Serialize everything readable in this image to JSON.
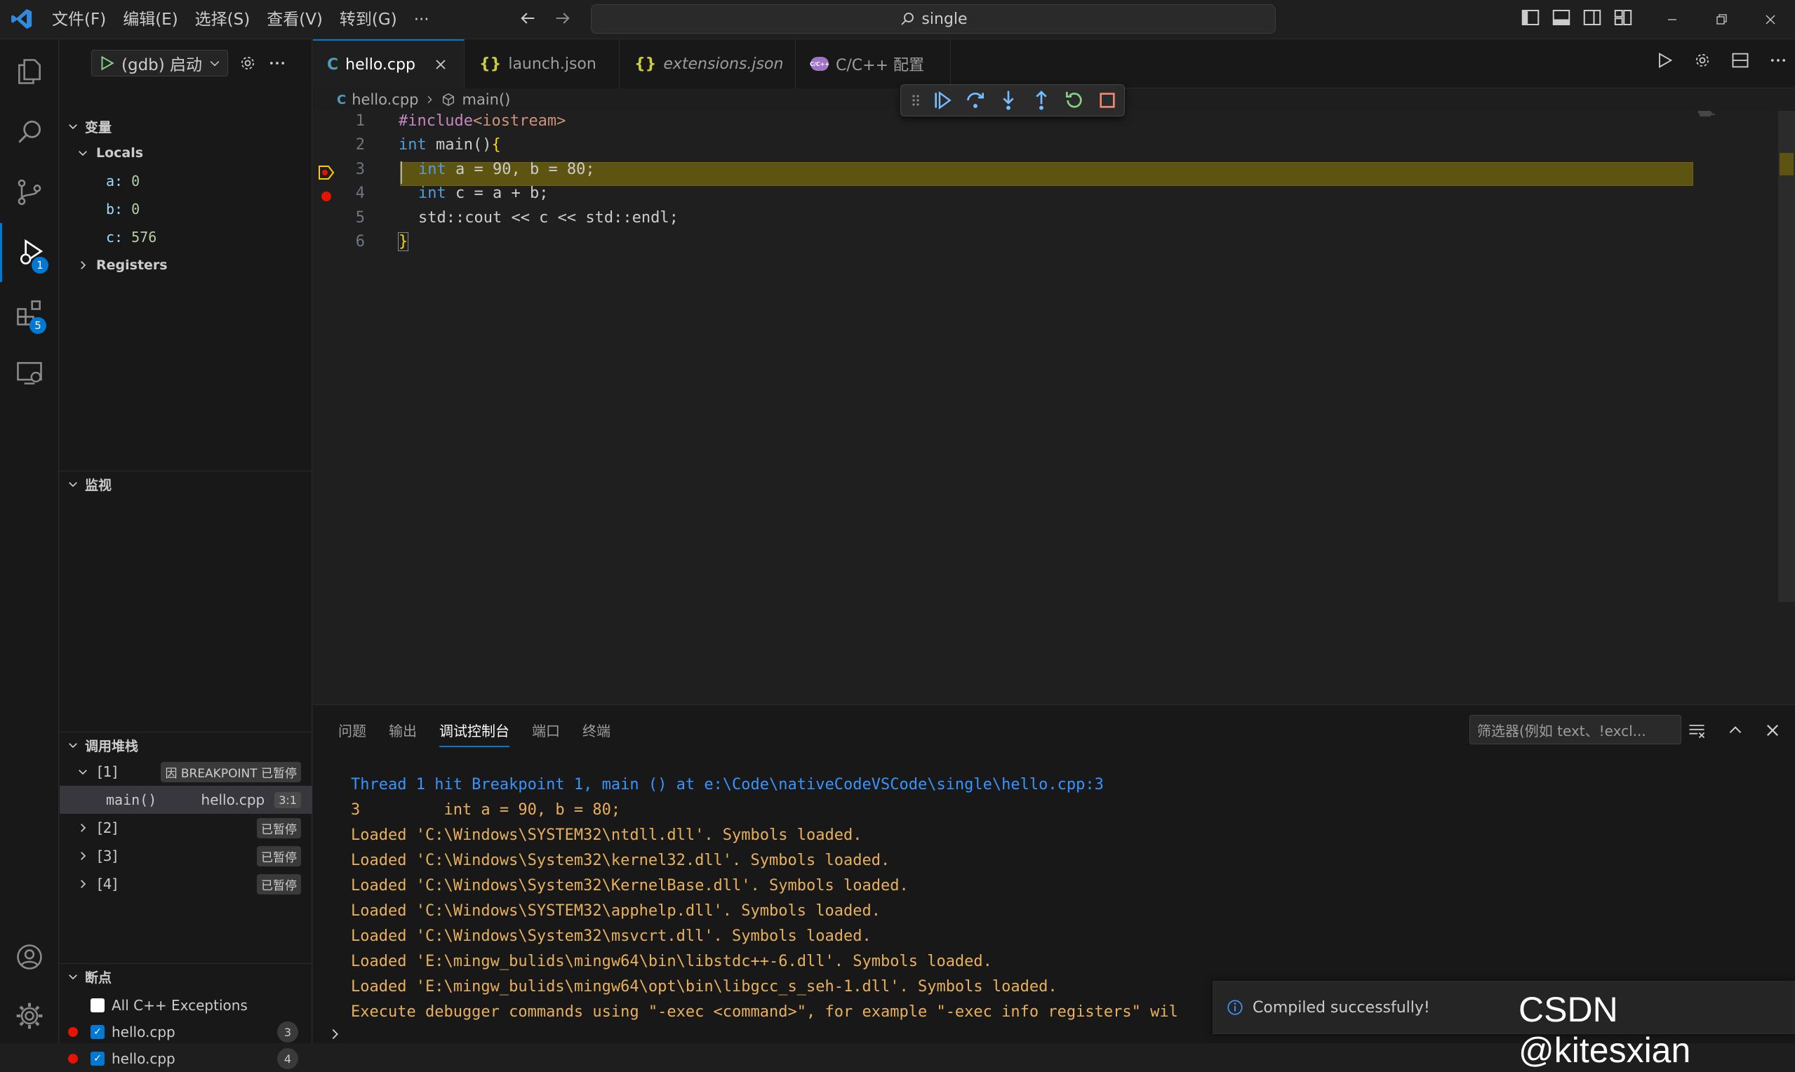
{
  "titlebar": {
    "menu": [
      "文件(F)",
      "编辑(E)",
      "选择(S)",
      "查看(V)",
      "转到(G)",
      "···"
    ],
    "search": "single"
  },
  "activity": {
    "debug_badge": "1",
    "extensions_badge": "5"
  },
  "sidebar": {
    "config": "(gdb) 启动",
    "variables_title": "变量",
    "locals_label": "Locals",
    "locals": [
      {
        "name": "a",
        "value": "0"
      },
      {
        "name": "b",
        "value": "0"
      },
      {
        "name": "c",
        "value": "576"
      }
    ],
    "registers_label": "Registers",
    "watch_title": "监视",
    "callstack_title": "调用堆栈",
    "threads": [
      {
        "id": "[1]",
        "status": "因 BREAKPOINT 已暂停"
      },
      {
        "id": "[2]",
        "status": "已暂停"
      },
      {
        "id": "[3]",
        "status": "已暂停"
      },
      {
        "id": "[4]",
        "status": "已暂停"
      }
    ],
    "frame": {
      "fn": "main()",
      "file": "hello.cpp",
      "pos": "3:1"
    },
    "breakpoints_title": "断点",
    "breakpoints": [
      {
        "label": "All C++ Exceptions",
        "count": ""
      },
      {
        "label": "hello.cpp",
        "count": "3"
      },
      {
        "label": "hello.cpp",
        "count": "4"
      }
    ]
  },
  "tabs": [
    {
      "label": "hello.cpp",
      "icon": "C"
    },
    {
      "label": "launch.json",
      "icon": "{}"
    },
    {
      "label": "extensions.json",
      "icon": "{}"
    },
    {
      "label": "C/C++ 配置",
      "icon": "C/C++"
    }
  ],
  "breadcrumb": {
    "file": "hello.cpp",
    "symbol": "main()"
  },
  "editor": {
    "line_numbers": [
      "1",
      "2",
      "3",
      "4",
      "5",
      "6"
    ],
    "lines": {
      "l1_pp": "#include",
      "l1_hdr": "<iostream>",
      "l2_kw": "int",
      "l2_rest": " main()",
      "l2_brace": "{",
      "l3_kw": "int",
      "l3_rest": " a = 90, b = 80;",
      "l4_kw": "int",
      "l4_rest": " c = a + b;",
      "l5": "std::cout << c << std::endl;",
      "l6_brace": "}"
    }
  },
  "panel": {
    "tabs": [
      "问题",
      "输出",
      "调试控制台",
      "端口",
      "终端"
    ],
    "filter_placeholder": "筛选器(例如 text、!excl...",
    "console": [
      {
        "text": "Thread 1 hit Breakpoint 1, main () at e:\\Code\\nativeCodeVSCode\\single\\hello.cpp:3",
        "color": "blue"
      },
      {
        "text": "3         int a = 90, b = 80;",
        "color": "orange"
      },
      {
        "text": "Loaded 'C:\\Windows\\SYSTEM32\\ntdll.dll'. Symbols loaded.",
        "color": "orange"
      },
      {
        "text": "Loaded 'C:\\Windows\\System32\\kernel32.dll'. Symbols loaded.",
        "color": "orange"
      },
      {
        "text": "Loaded 'C:\\Windows\\System32\\KernelBase.dll'. Symbols loaded.",
        "color": "orange"
      },
      {
        "text": "Loaded 'C:\\Windows\\SYSTEM32\\apphelp.dll'. Symbols loaded.",
        "color": "orange"
      },
      {
        "text": "Loaded 'C:\\Windows\\System32\\msvcrt.dll'. Symbols loaded.",
        "color": "orange"
      },
      {
        "text": "Loaded 'E:\\mingw_bulids\\mingw64\\bin\\libstdc++-6.dll'. Symbols loaded.",
        "color": "orange"
      },
      {
        "text": "Loaded 'E:\\mingw_bulids\\mingw64\\opt\\bin\\libgcc_s_seh-1.dll'. Symbols loaded.",
        "color": "orange"
      },
      {
        "text": "Execute debugger commands using \"-exec <command>\", for example \"-exec info registers\" wil",
        "color": "orange"
      }
    ]
  },
  "toast": {
    "message": "Compiled successfully!"
  },
  "watermark": "CSDN @kitesxian"
}
